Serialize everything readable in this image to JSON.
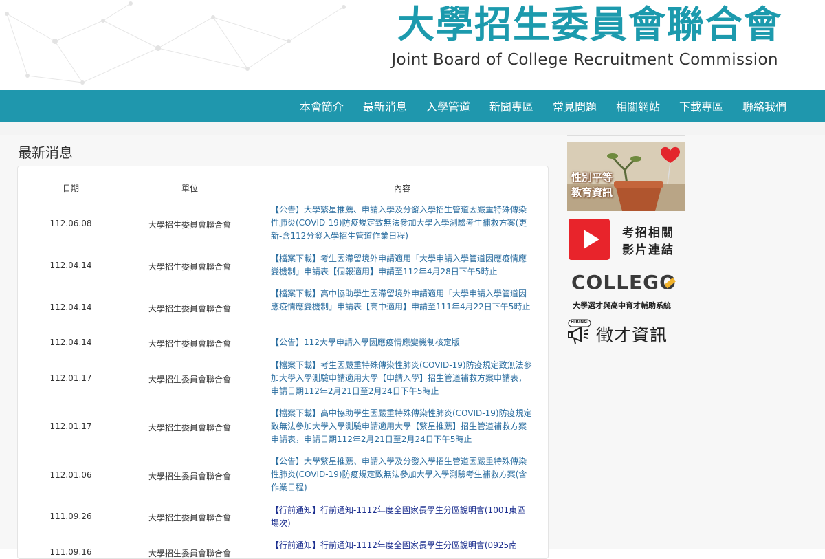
{
  "header": {
    "title_zh": "大學招生委員會聯合會",
    "title_en": "Joint Board of College Recruitment Commission",
    "brand_color": "#1c9aad"
  },
  "nav": {
    "items": [
      "本會簡介",
      "最新消息",
      "入學管道",
      "新聞專區",
      "常見問題",
      "相關網站",
      "下載專區",
      "聯絡我們"
    ],
    "bg_color": "#1f97ad"
  },
  "page": {
    "title": "最新消息"
  },
  "news": {
    "headers": {
      "date": "日期",
      "unit": "單位",
      "content": "內容"
    },
    "rows": [
      {
        "date": "112.06.08",
        "unit": "大學招生委員會聯合會",
        "content": "【公告】大學繁星推薦、申請入學及分發入學招生管道因嚴重特殊傳染性肺炎(COVID-19)防疫規定致無法參加大學入學測驗考生補救方案(更新-含112分發入學招生管道作業日程)"
      },
      {
        "date": "112.04.14",
        "unit": "大學招生委員會聯合會",
        "content": "【檔案下載】考生因滯留境外申請適用「大學申請入學管道因應疫情應變機制」申請表【個報適用】申請至112年4月28日下午5時止"
      },
      {
        "date": "112.04.14",
        "unit": "大學招生委員會聯合會",
        "content": "【檔案下載】高中協助學生因滯留境外申請適用「大學申請入學管道因應疫情應變機制」申請表【高中適用】申請至111年4月22日下午5時止"
      },
      {
        "date": "112.04.14",
        "unit": "大學招生委員會聯合會",
        "content": "【公告】112大學申請入學因應疫情應變機制核定版"
      },
      {
        "date": "112.01.17",
        "unit": "大學招生委員會聯合會",
        "content": "【檔案下載】考生因嚴重特殊傳染性肺炎(COVID-19)防疫規定致無法參加大學入學測驗申請適用大學【申請入學】招生管道補救方案申請表，申請日期112年2月21日至2月24日下午5時止"
      },
      {
        "date": "112.01.17",
        "unit": "大學招生委員會聯合會",
        "content": "【檔案下載】高中協助學生因嚴重特殊傳染性肺炎(COVID-19)防疫規定致無法參加大學入學測驗申請適用大學【繁星推薦】招生管道補救方案申請表，申請日期112年2月21日至2月24日下午5時止"
      },
      {
        "date": "112.01.06",
        "unit": "大學招生委員會聯合會",
        "content": "【公告】大學繁星推薦、申請入學及分發入學招生管道因嚴重特殊傳染性肺炎(COVID-19)防疫規定致無法參加大學入學測驗考生補救方案(含作業日程)"
      },
      {
        "date": "111.09.26",
        "unit": "大學招生委員會聯合會",
        "content": "【行前通知】行前通知-1112年度全國家長學生分區說明會(1001東區場次)"
      },
      {
        "date": "111.09.16",
        "unit": "大學招生委員會聯合會",
        "content": "【行前通知】行前通知-1112年度全國家長學生分區說明會(0925南"
      }
    ]
  },
  "sidebar": {
    "gender_banner": {
      "label": "性別平等教育資訊",
      "icon": "heart-plant-icon"
    },
    "video_banner": {
      "label_line1": "考招相關",
      "label_line2": "影片連結",
      "icon": "youtube-play-icon"
    },
    "college_banner": {
      "logo_text": "COLLEGO",
      "caption": "大學選才與高中育才輔助系統"
    },
    "hiring_banner": {
      "label": "徵才資訊",
      "badge": "HIRING!",
      "icon": "megaphone-icon"
    }
  }
}
